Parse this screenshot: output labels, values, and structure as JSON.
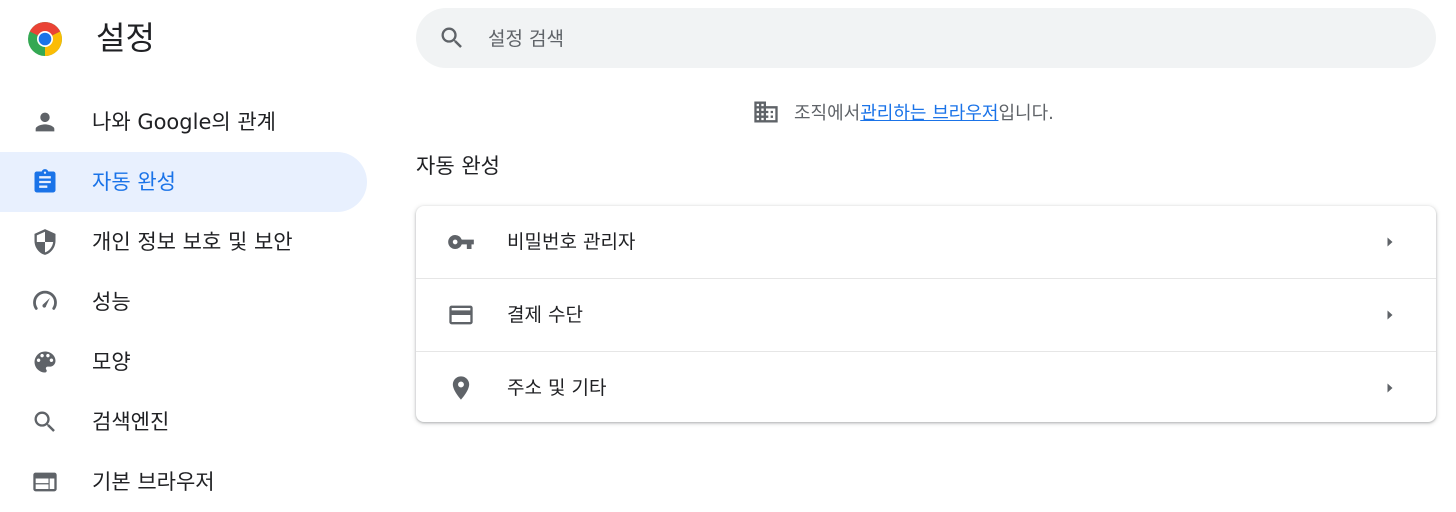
{
  "header": {
    "title": "설정",
    "logo_icon": "chrome-logo-icon"
  },
  "search": {
    "placeholder": "설정 검색",
    "value": "",
    "icon": "search-icon"
  },
  "sidebar": {
    "items": [
      {
        "label": "나와 Google의 관계",
        "icon": "person-icon",
        "active": false
      },
      {
        "label": "자동 완성",
        "icon": "clipboard-icon",
        "active": true
      },
      {
        "label": "개인 정보 보호 및 보안",
        "icon": "shield-icon",
        "active": false
      },
      {
        "label": "성능",
        "icon": "speedometer-icon",
        "active": false
      },
      {
        "label": "모양",
        "icon": "palette-icon",
        "active": false
      },
      {
        "label": "검색엔진",
        "icon": "search-icon",
        "active": false
      },
      {
        "label": "기본 브라우저",
        "icon": "browser-window-icon",
        "active": false
      }
    ]
  },
  "managed_notice": {
    "prefix": "조직에서 ",
    "link": "관리하는 브라우저",
    "suffix": "입니다.",
    "icon": "building-icon"
  },
  "section": {
    "title": "자동 완성",
    "rows": [
      {
        "label": "비밀번호 관리자",
        "icon": "key-icon"
      },
      {
        "label": "결제 수단",
        "icon": "credit-card-icon"
      },
      {
        "label": "주소 및 기타",
        "icon": "location-pin-icon"
      }
    ]
  },
  "colors": {
    "accent": "#1a73e8",
    "active_bg": "#e8f0fe",
    "icon": "#5f6368",
    "search_bg": "#f1f3f4"
  }
}
